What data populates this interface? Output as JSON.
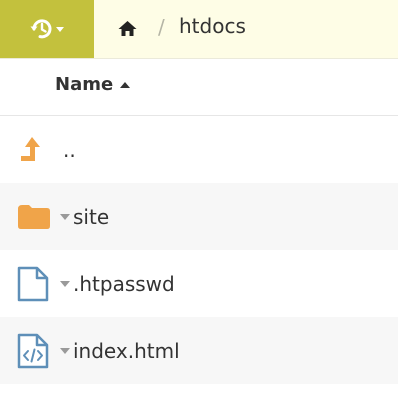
{
  "toolbar": {
    "history_icon": "history-icon",
    "history_color": "#c3c13d",
    "home_icon": "home-icon",
    "separator": "/",
    "current_folder": "htdocs"
  },
  "table": {
    "sort_column": "Name",
    "sort_direction": "ascending"
  },
  "files": [
    {
      "name": "..",
      "type": "parent",
      "icon": "up-arrow-icon"
    },
    {
      "name": "site",
      "type": "folder",
      "icon": "folder-icon"
    },
    {
      "name": ".htpasswd",
      "type": "file",
      "icon": "file-icon"
    },
    {
      "name": "index.html",
      "type": "code-file",
      "icon": "code-file-icon"
    }
  ],
  "colors": {
    "accent": "#c3c13d",
    "folder": "#f0a449",
    "file_outline": "#5e8fb8"
  }
}
